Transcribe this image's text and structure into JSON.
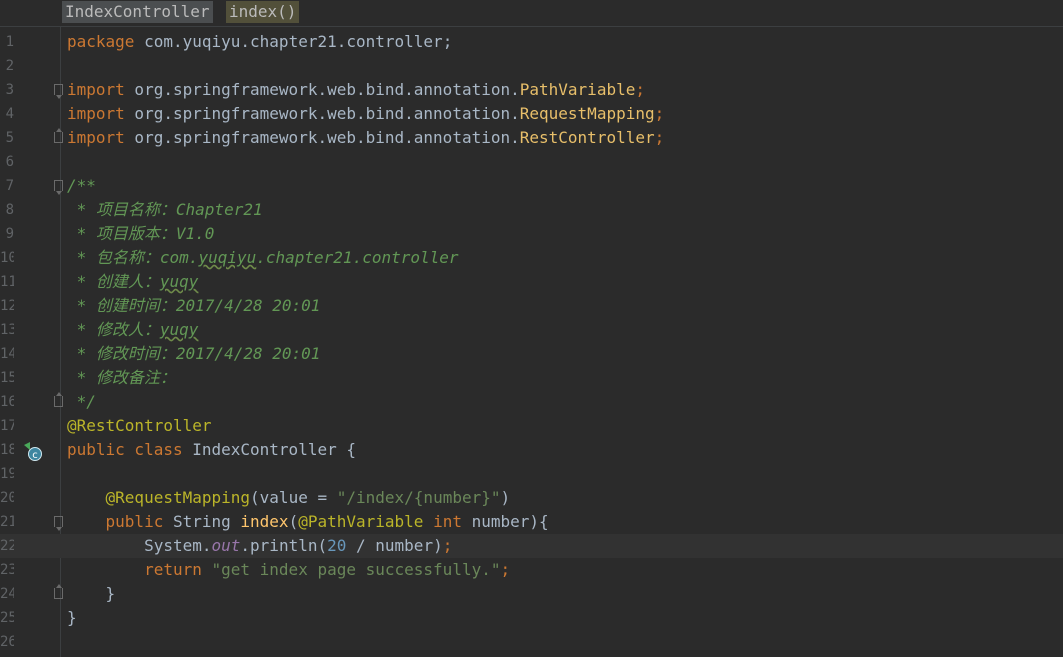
{
  "breadcrumb": {
    "class_name": "IndexController",
    "method_name": "index()"
  },
  "line_numbers": [
    "1",
    "2",
    "3",
    "4",
    "5",
    "6",
    "7",
    "8",
    "9",
    "10",
    "11",
    "12",
    "13",
    "14",
    "15",
    "16",
    "17",
    "18",
    "19",
    "20",
    "21",
    "22",
    "23",
    "24",
    "25",
    "26"
  ],
  "code": {
    "l1_kw": "package",
    "l1_rest": " com.yuqiyu.chapter21.controller;",
    "import_kw": "import",
    "import_pkg": " org.springframework.web.bind.annotation.",
    "l3_cls": "PathVariable",
    "l4_cls": "RequestMapping",
    "l5_cls": "RestController",
    "semi": ";",
    "l7": "/**",
    "l8": " * 项目名称：Chapter21",
    "l9": " * 项目版本：V1.0",
    "l10_a": " * 包名称：com.",
    "l10_b": "yuqiyu",
    "l10_c": ".chapter21.controller",
    "l11_a": " * 创建人：",
    "l11_b": "yuqy",
    "l12": " * 创建时间：2017/4/28 20:01",
    "l13_a": " * 修改人：",
    "l13_b": "yuqy",
    "l14": " * 修改时间：2017/4/28 20:01",
    "l15": " * 修改备注：",
    "l16": " */",
    "l17": "@RestController",
    "l18_kw": "public class",
    "l18_rest": " IndexController {",
    "l20_indent": "    ",
    "l20_ann": "@RequestMapping",
    "l20_a": "(value = ",
    "l20_str": "\"/index/{number}\"",
    "l20_b": ")",
    "l21_kw": "public",
    "l21_a": " String ",
    "l21_fn": "index",
    "l21_b": "(",
    "l21_ann": "@PathVariable",
    "l21_int": " int",
    "l21_c": " number){",
    "l22_indent": "        ",
    "l22_a": "System.",
    "l22_field": "out",
    "l22_b": ".println(",
    "l22_num": "20",
    "l22_c": " / number)",
    "l23_kw": "return",
    "l23_str": " \"get index page successfully.\"",
    "l24": "    }",
    "l25": "}"
  },
  "icons": {
    "class_gutter_icon": "run-class-icon"
  },
  "colors": {
    "background": "#2b2b2b",
    "keyword": "#cc7832",
    "annotation": "#bbb529",
    "comment": "#629755",
    "string": "#6a8759",
    "number": "#6897bb"
  }
}
